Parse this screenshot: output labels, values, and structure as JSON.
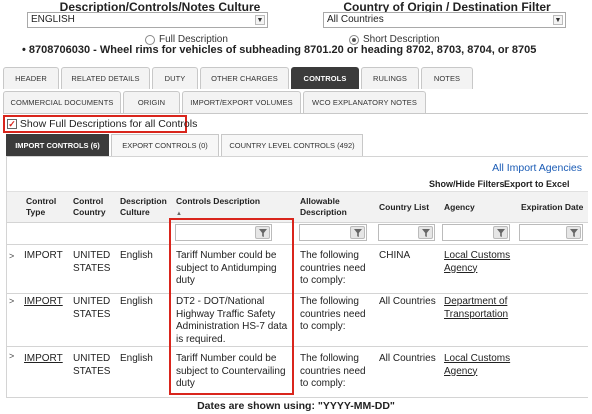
{
  "culture": {
    "label": "Description/Controls/Notes Culture",
    "value": "ENGLISH"
  },
  "country_filter": {
    "label": "Country of Origin / Destination Filter",
    "value": "All Countries"
  },
  "description_mode": {
    "full_label": "Full Description",
    "short_label": "Short Description",
    "selected": "short"
  },
  "item": "8708706030 - Wheel rims for vehicles of subheading 8701.20 or heading 8702, 8703, 8704, or 8705",
  "tabs_row1": [
    "HEADER",
    "RELATED DETAILS",
    "DUTY",
    "OTHER CHARGES",
    "CONTROLS",
    "RULINGS",
    "NOTES"
  ],
  "tabs_row2": [
    "COMMERCIAL DOCUMENTS",
    "ORIGIN",
    "IMPORT/EXPORT VOLUMES",
    "WCO EXPLANATORY NOTES"
  ],
  "active_tab": "CONTROLS",
  "show_full_label": "Show Full Descriptions for all Controls",
  "show_full_checked": true,
  "subtabs": [
    "IMPORT CONTROLS (6)",
    "EXPORT CONTROLS (0)",
    "COUNTRY LEVEL CONTROLS (492)"
  ],
  "all_import_agencies": "All Import Agencies",
  "show_hide_filters": "Show/Hide Filters",
  "export_excel": "Export to Excel",
  "columns": {
    "control_type": "Control Type",
    "control_country": "Control Country",
    "description_culture": "Description Culture",
    "controls_description": "Controls Description",
    "allowable_description": "Allowable Description",
    "country_list": "Country List",
    "agency": "Agency",
    "expiration_date": "Expiration Date"
  },
  "rows": [
    {
      "type": "IMPORT",
      "type_link": false,
      "country": "UNITED STATES",
      "culture": "English",
      "description": "Tariff Number could be subject to Antidumping duty",
      "allowable": "The following countries need to comply:",
      "country_list": "CHINA",
      "agency": "Local Customs Agency"
    },
    {
      "type": "IMPORT",
      "type_link": true,
      "country": "UNITED STATES",
      "culture": "English",
      "description": "DT2 - DOT/National Highway Traffic Safety Administration HS-7 data is required.",
      "allowable": "The following countries need to comply:",
      "country_list": "All Countries",
      "agency": "Department of Transportation"
    },
    {
      "type": "IMPORT",
      "type_link": true,
      "country": "UNITED STATES",
      "culture": "English",
      "description": "Tariff Number could be subject to Countervailing duty",
      "allowable": "The following countries need to comply:",
      "country_list": "All Countries",
      "agency": "Local Customs Agency"
    }
  ],
  "footer_note": "Dates are shown using: \"YYYY-MM-DD\""
}
